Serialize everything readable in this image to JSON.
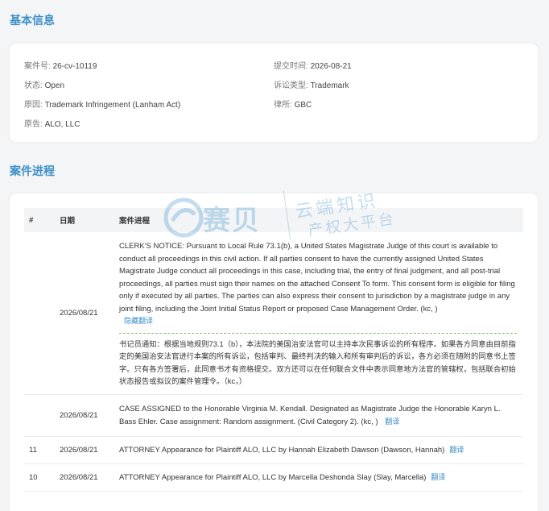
{
  "basic_info": {
    "title": "基本信息",
    "case_no_label": "案件号:",
    "case_no": "26-cv-10119",
    "filed_label": "提交时间:",
    "filed": "2026-08-21",
    "status_label": "状态:",
    "status": "Open",
    "type_label": "诉讼类型:",
    "type": "Trademark",
    "cause_label": "原因:",
    "cause": "Trademark Infringement (Lanham Act)",
    "firm_label": "律所:",
    "firm": "GBC",
    "plaintiff_label": "原告:",
    "plaintiff": "ALO, LLC"
  },
  "progress": {
    "title": "案件进程",
    "headers": {
      "num": "#",
      "date": "日期",
      "content": "案件进程"
    },
    "rows": [
      {
        "num": "",
        "date": "2026/08/21",
        "text": "CLERK'S NOTICE: Pursuant to Local Rule 73.1(b), a United States Magistrate Judge of this court is available to conduct all proceedings in this civil action. If all parties consent to have the currently assigned United States Magistrate Judge conduct all proceedings in this case, including trial, the entry of final judgment, and all post-trial proceedings, all parties must sign their names on the attached Consent To form. This consent form is eligible for filing only if executed by all parties. The parties can also express their consent to jurisdiction by a magistrate judge in any joint filing, including the Joint Initial Status Report or proposed Case Management Order. (kc, )",
        "action": "隐藏翻译",
        "translation": "书记员通知：根据当地规则73.1（b），本法院的美国治安法官可以主持本次民事诉讼的所有程序。如果各方同意由目前指定的美国治安法官进行本案的所有诉讼，包括审判、最终判决的输入和所有审判后的诉讼，各方必须在随附的同意书上签字。只有各方签署后，此同意书才有资格提交。双方还可以在任何联合文件中表示同意地方法官的管辖权，包括联合初始状态报告或拟议的案件管理令。（kc，）"
      },
      {
        "num": "",
        "date": "2026/08/21",
        "text": "CASE ASSIGNED to the Honorable Virginia M. Kendall. Designated as Magistrate Judge the Honorable Karyn L. Bass Ehler. Case assignment: Random assignment. (Civil Category 2). (kc, )",
        "action": "翻译"
      },
      {
        "num": "11",
        "date": "2026/08/21",
        "text": "ATTORNEY Appearance for Plaintiff ALO, LLC by Hannah Elizabeth Dawson (Dawson, Hannah)",
        "action": "翻译"
      },
      {
        "num": "10",
        "date": "2026/08/21",
        "text": "ATTORNEY Appearance for Plaintiff ALO, LLC by Marcella Deshonda Slay (Slay, Marcella)",
        "action": "翻译"
      }
    ]
  },
  "watermark": {
    "logo_text": "赛贝",
    "line1": "云端知识",
    "line2": "产权大平台"
  }
}
